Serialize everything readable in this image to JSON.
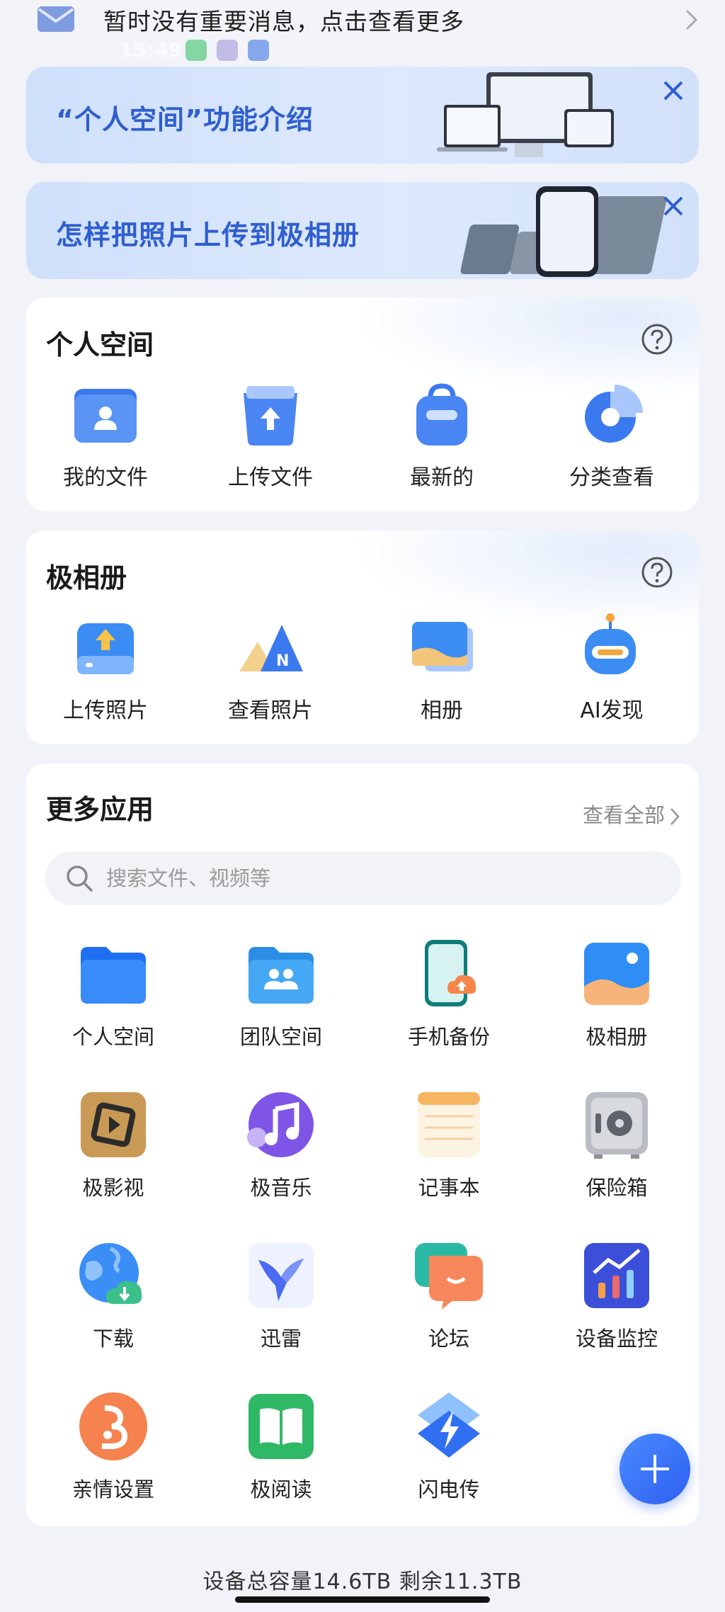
{
  "notice": {
    "text": "暂时没有重要消息，点击查看更多",
    "icon": "mail-icon"
  },
  "status_bar": {
    "time": "15:49"
  },
  "banners": [
    {
      "title": "“个人空间”功能介绍",
      "close_icon": "close-icon"
    },
    {
      "title": "怎样把照片上传到极相册",
      "close_icon": "close-icon"
    }
  ],
  "personal_space": {
    "title": "个人空间",
    "items": [
      {
        "label": "我的文件",
        "icon": "folder-user-icon"
      },
      {
        "label": "上传文件",
        "icon": "upload-folder-icon"
      },
      {
        "label": "最新的",
        "icon": "recent-bag-icon"
      },
      {
        "label": "分类查看",
        "icon": "pie-category-icon"
      }
    ]
  },
  "photo_album": {
    "title": "极相册",
    "items": [
      {
        "label": "上传照片",
        "icon": "upload-photo-icon"
      },
      {
        "label": "查看照片",
        "icon": "view-photo-icon"
      },
      {
        "label": "相册",
        "icon": "album-icon"
      },
      {
        "label": "AI发现",
        "icon": "ai-robot-icon"
      }
    ]
  },
  "more_apps": {
    "title": "更多应用",
    "view_all": "查看全部",
    "search_placeholder": "搜索文件、视频等",
    "apps": [
      {
        "label": "个人空间",
        "icon": "folder-icon"
      },
      {
        "label": "团队空间",
        "icon": "team-folder-icon"
      },
      {
        "label": "手机备份",
        "icon": "phone-backup-icon"
      },
      {
        "label": "极相册",
        "icon": "photo-album-icon"
      },
      {
        "label": "极影视",
        "icon": "video-icon"
      },
      {
        "label": "极音乐",
        "icon": "music-icon"
      },
      {
        "label": "记事本",
        "icon": "notepad-icon"
      },
      {
        "label": "保险箱",
        "icon": "safe-icon"
      },
      {
        "label": "下载",
        "icon": "download-globe-icon"
      },
      {
        "label": "迅雷",
        "icon": "thunder-bird-icon"
      },
      {
        "label": "论坛",
        "icon": "forum-chat-icon"
      },
      {
        "label": "设备监控",
        "icon": "monitor-chart-icon"
      },
      {
        "label": "亲情设置",
        "icon": "family-icon"
      },
      {
        "label": "极阅读",
        "icon": "book-icon"
      },
      {
        "label": "闪电传",
        "icon": "lightning-icon"
      }
    ]
  },
  "fab": {
    "icon": "plus-icon"
  },
  "footer": {
    "text": "设备总容量14.6TB  剩余11.3TB"
  },
  "colors": {
    "accent": "#2f5ecf",
    "background": "#f1f3f9",
    "fab": "#3a70f5"
  }
}
